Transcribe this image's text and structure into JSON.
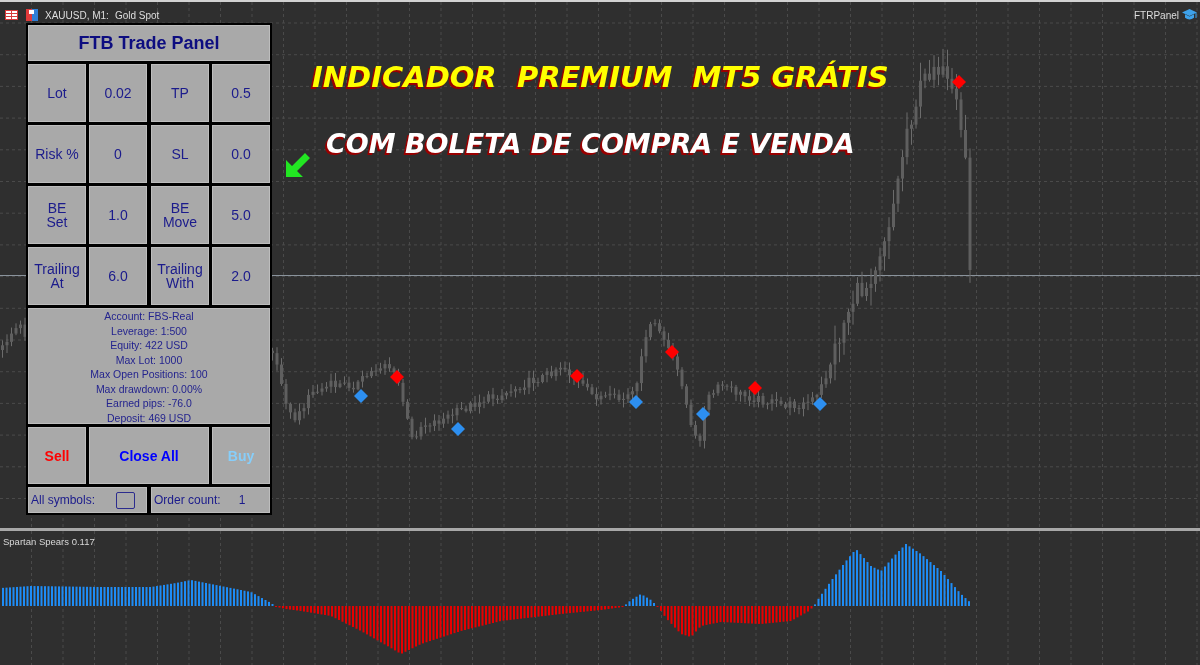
{
  "chart_header": {
    "symbol": "XAUUSD, M1:",
    "description": "Gold Spot",
    "expert": "FTRPanel"
  },
  "headline": {
    "title": "INDICADOR  PREMIUM  MT5 GRÁTIS",
    "subtitle": "COM BOLETA DE COMPRA E VENDA"
  },
  "panel": {
    "title": "FTB Trade Panel",
    "params": [
      {
        "label": "Lot",
        "value": "0.02"
      },
      {
        "label": "TP",
        "value": "0.5"
      },
      {
        "label": "Risk %",
        "value": "0"
      },
      {
        "label": "SL",
        "value": "0.0"
      },
      {
        "label": "BE\nSet",
        "value": "1.0"
      },
      {
        "label": "BE\nMove",
        "value": "5.0"
      },
      {
        "label": "Trailing\nAt",
        "value": "6.0"
      },
      {
        "label": "Trailing\nWith",
        "value": "2.0"
      }
    ],
    "info": [
      "Account: FBS-Real",
      "Leverage: 1:500",
      "Equity: 422 USD",
      "Max Lot: 1000",
      "Max Open Positions: 100",
      "Max drawdown: 0.00%",
      "Earned pips: -76.0",
      "Deposit: 469 USD"
    ],
    "buttons": [
      {
        "kind": "sell",
        "label": "Sell"
      },
      {
        "kind": "close_all",
        "label": "Close All"
      },
      {
        "kind": "buy",
        "label": "Buy"
      }
    ],
    "all_symbols": {
      "label": "All symbols:",
      "checked": false
    },
    "order_count": {
      "label": "Order count:",
      "value": "1"
    }
  },
  "chart": {
    "signals": [
      {
        "color": "#2d8ff0"
      },
      {
        "color": "#ff0000"
      },
      {
        "color": "#2d8ff0"
      },
      {
        "color": "#ff0000"
      },
      {
        "color": "#2d8ff0"
      },
      {
        "color": "#ff0000"
      },
      {
        "color": "#2d8ff0"
      },
      {
        "color": "#ff0000"
      },
      {
        "color": "#2d8ff0"
      },
      {
        "color": "#ff0000"
      }
    ]
  },
  "indicator": {
    "title": "Spartan Spears 0.117"
  }
}
